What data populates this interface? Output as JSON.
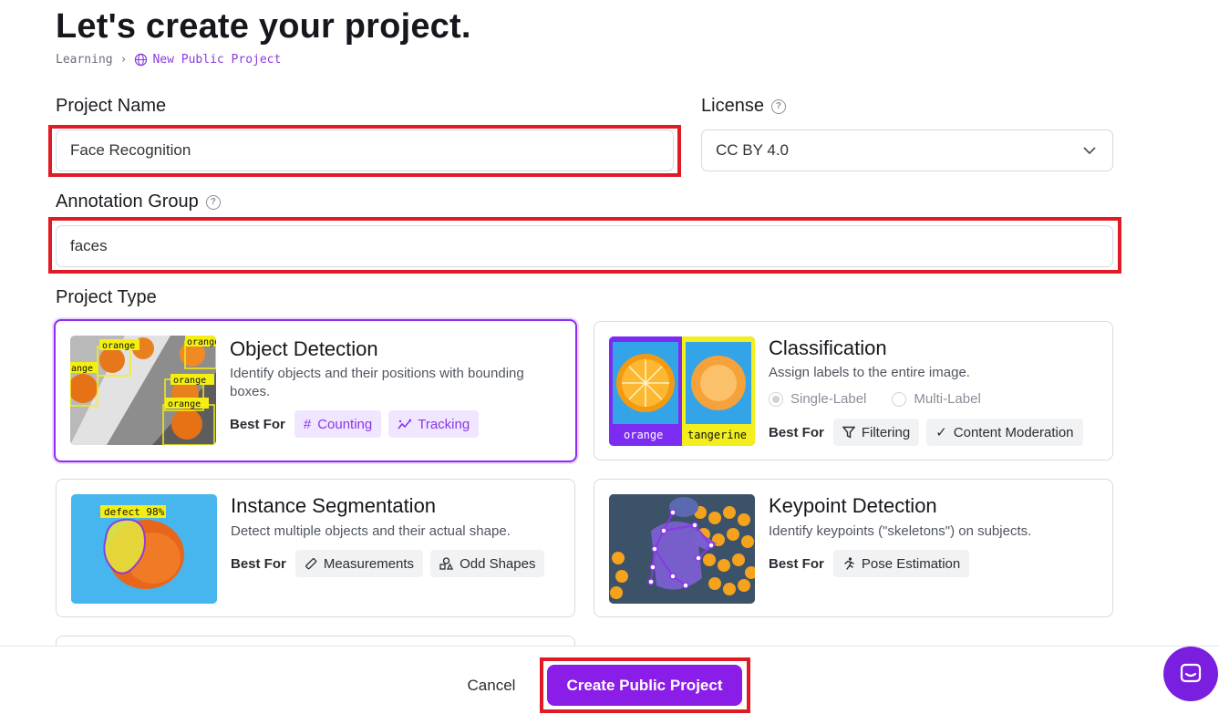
{
  "page": {
    "title": "Let's create your project.",
    "breadcrumb": {
      "parent": "Learning",
      "current": "New Public Project"
    }
  },
  "form": {
    "project_name": {
      "label": "Project Name",
      "value": "Face Recognition"
    },
    "license": {
      "label": "License",
      "value": "CC BY 4.0"
    },
    "annotation_group": {
      "label": "Annotation Group",
      "value": "faces"
    },
    "project_type": {
      "label": "Project Type"
    }
  },
  "project_types": {
    "best_for": "Best For",
    "object_detection": {
      "title": "Object Detection",
      "description": "Identify objects and their positions with bounding boxes.",
      "chips": [
        "Counting",
        "Tracking"
      ],
      "thumb_labels": [
        "orange",
        "orange",
        "ange",
        "orange",
        "orange"
      ],
      "selected": true
    },
    "classification": {
      "title": "Classification",
      "description": "Assign labels to the entire image.",
      "radio_single": "Single-Label",
      "radio_multi": "Multi-Label",
      "chips": [
        "Filtering",
        "Content Moderation"
      ],
      "thumb_labels": [
        "orange",
        "tangerine"
      ]
    },
    "instance_segmentation": {
      "title": "Instance Segmentation",
      "description": "Detect multiple objects and their actual shape.",
      "chips": [
        "Measurements",
        "Odd Shapes"
      ],
      "thumb_label": "defect 98%"
    },
    "keypoint_detection": {
      "title": "Keypoint Detection",
      "description": "Identify keypoints (\"skeletons\") on subjects.",
      "chips": [
        "Pose Estimation"
      ]
    }
  },
  "footer": {
    "cancel": "Cancel",
    "create": "Create Public Project"
  },
  "colors": {
    "accent": "#8b1de8",
    "highlight": "#e11b26",
    "chip_purple_bg": "#f1e6ff"
  }
}
